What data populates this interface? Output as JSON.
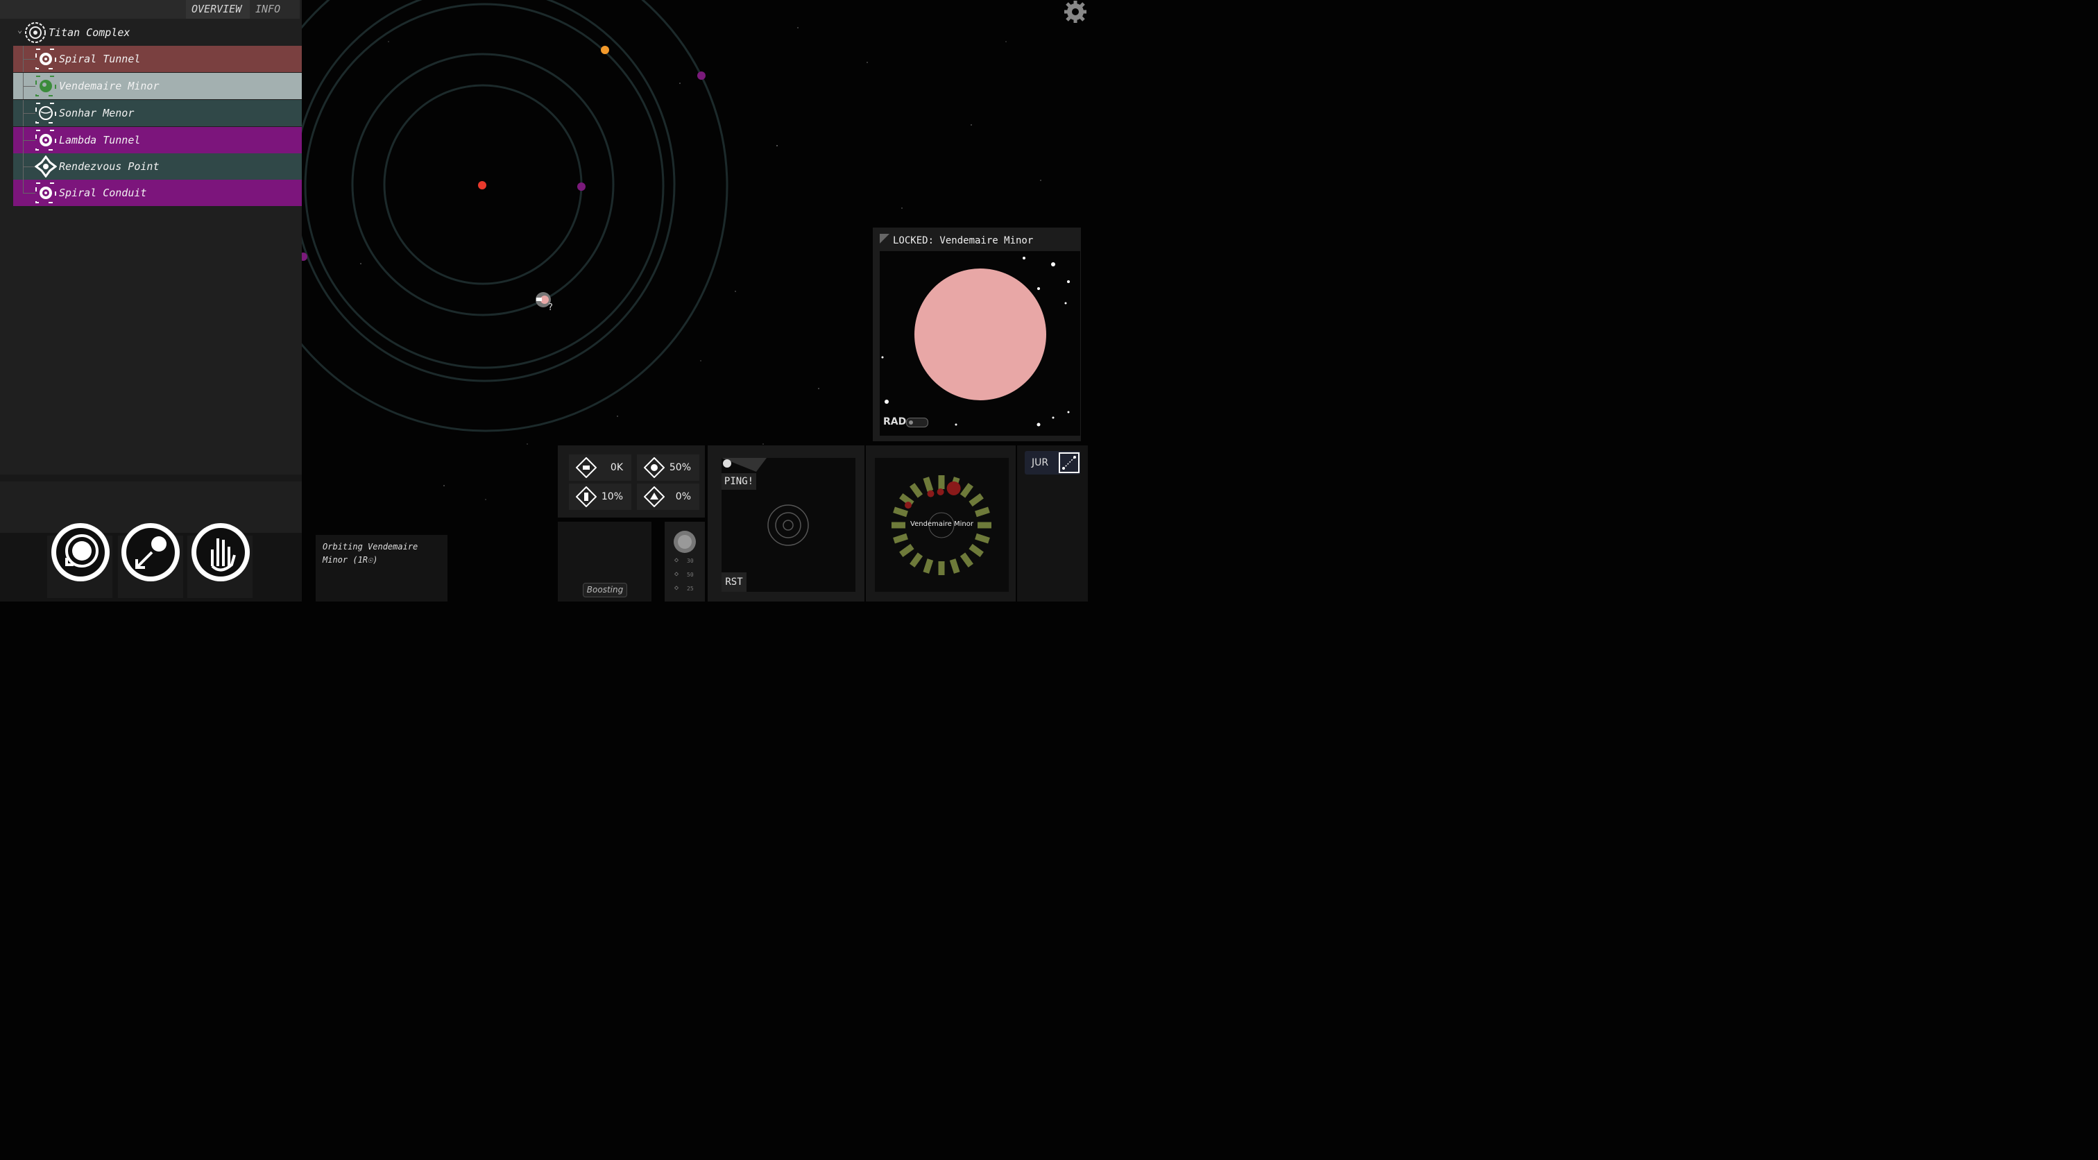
{
  "tabs": {
    "overview": "OVERVIEW",
    "info": "INFO"
  },
  "tree": {
    "root": "Titan Complex",
    "items": [
      {
        "label": "Spiral Tunnel",
        "color": "#7a4040",
        "icon": "spiral-tunnel-icon"
      },
      {
        "label": "Vendemaire Minor",
        "color": "#a3b0b0",
        "icon": "green-planet-icon"
      },
      {
        "label": "Sonhar Menor",
        "color": "#304848",
        "icon": "planet-icon"
      },
      {
        "label": "Lambda Tunnel",
        "color": "#7c157c",
        "icon": "tunnel-icon"
      },
      {
        "label": "Rendezvous Point",
        "color": "#304848",
        "icon": "rendezvous-icon"
      },
      {
        "label": "Spiral Conduit",
        "color": "#7c157c",
        "icon": "conduit-icon"
      }
    ]
  },
  "locked": {
    "title": "LOCKED: Vendemaire Minor",
    "rad_label": "RAD"
  },
  "stats": {
    "a": "0K",
    "b": "50%",
    "c": "10%",
    "d": "0%"
  },
  "orbit_status": {
    "line1": "Orbiting Vendemaire",
    "line2": "Minor (1R☉)"
  },
  "boost": {
    "label": "Boosting",
    "values": [
      "30",
      "50",
      "25"
    ]
  },
  "ping": {
    "label": "PING!",
    "reset": "RST"
  },
  "radar": {
    "target": "Vendemaire Minor"
  },
  "jur": {
    "label": "JUR"
  },
  "colors": {
    "star": "#e8392c",
    "accent_orange": "#f39a2c",
    "accent_purple": "#7a1a7a",
    "planet_pink": "#e8a7a6"
  }
}
